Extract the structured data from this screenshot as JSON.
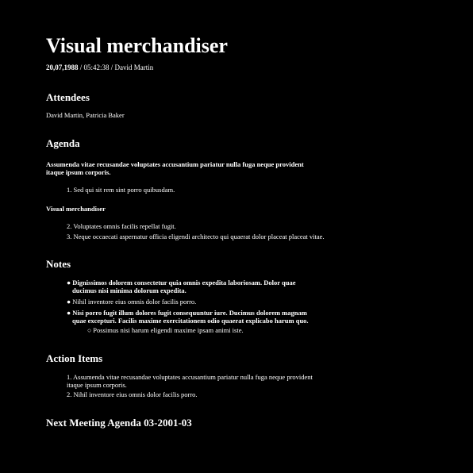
{
  "title": "Visual merchandiser",
  "meta": {
    "date": "20,07,1988",
    "rest": " / 05:42:38 / David Martin"
  },
  "attendees": {
    "heading": "Attendees",
    "names": "David Martin, Patricia Baker"
  },
  "agenda": {
    "heading": "Agenda",
    "intro": "Assumenda vitae recusandae voluptates accusantium pariatur nulla fuga neque provident itaque ipsum corporis.",
    "item1": "1. Sed qui sit rem sint porro quibusdam.",
    "subheading": "Visual merchandiser",
    "item2": "2. Voluptates omnis facilis repellat fugit.",
    "item3": "3. Neque occaecati aspernatur officia eligendi architecto qui quaerat dolor placeat placeat vitae."
  },
  "notes": {
    "heading": "Notes",
    "bullet1": "● Dignissimos dolorem consectetur quia omnis expedita laboriosam. Dolor quae ducimus nisi minima dolorum expedita.",
    "bullet2": "● Nihil inventore eius omnis dolor facilis porro.",
    "bullet3": "● Nisi porro fugit illum dolores fugit consequuntur iure. Ducimus dolorem magnam quae excepturi. Facilis maxime exercitationem odio quaerat explicabo harum quo.",
    "subbullet": "○ Possimus nisi harum eligendi maxime ipsam animi iste."
  },
  "action_items": {
    "heading": "Action Items",
    "item1": "1. Assumenda vitae recusandae voluptates accusantium pariatur nulla fuga neque provident itaque ipsum corporis.",
    "item2": "2. Nihil inventore eius omnis dolor facilis porro."
  },
  "next_meeting": {
    "heading": "Next Meeting Agenda 03-2001-03"
  },
  "colors": {
    "background": "#000000",
    "text": "#ffffff"
  }
}
